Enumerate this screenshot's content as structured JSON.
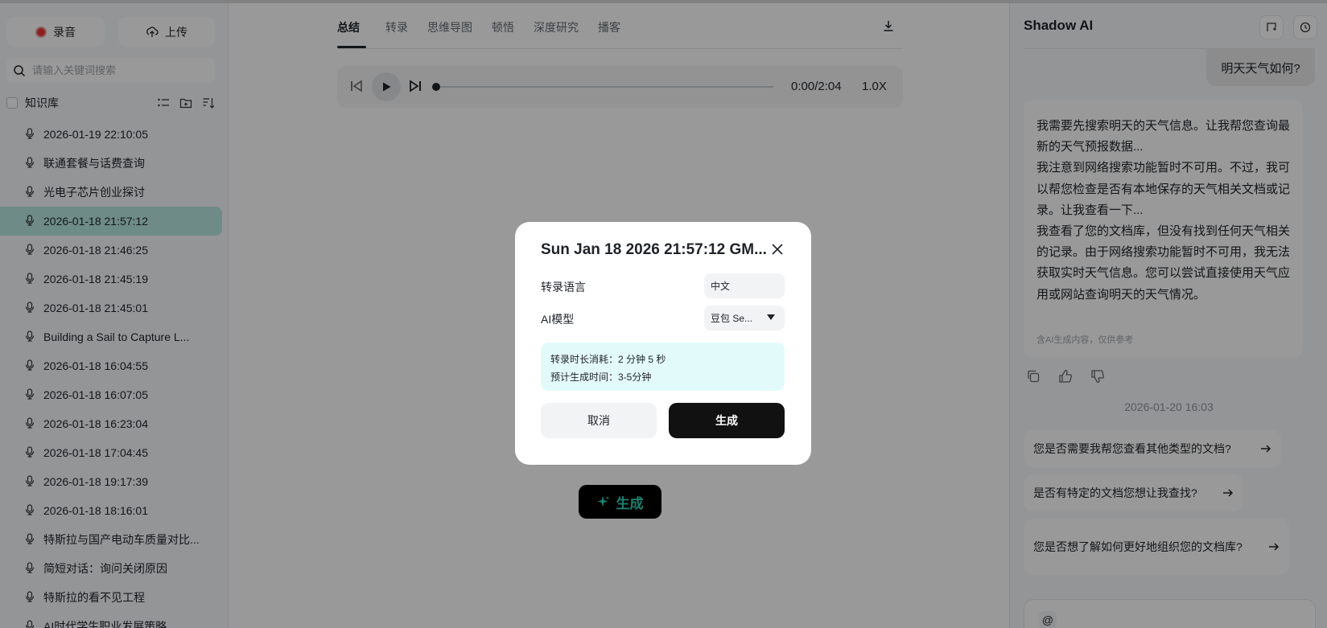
{
  "sidebar": {
    "record_label": "录音",
    "upload_label": "上传",
    "search_placeholder": "请输入关键词搜索",
    "kb_label": "知识库",
    "items": [
      "2026-01-19 22:10:05",
      "联通套餐与话费查询",
      "光电子芯片创业探讨",
      "2026-01-18 21:57:12",
      "2026-01-18 21:46:25",
      "2026-01-18 21:45:19",
      "2026-01-18 21:45:01",
      "Building a Sail to Capture L...",
      "2026-01-18 16:04:55",
      "2026-01-18 16:07:05",
      "2026-01-18 16:23:04",
      "2026-01-18 17:04:45",
      "2026-01-18 19:17:39",
      "2026-01-18 18:16:01",
      "特斯拉与国产电动车质量对比...",
      "简短对话：询问关闭原因",
      "特斯拉的看不见工程",
      "AI时代学生职业发展策略"
    ],
    "active_index": 3
  },
  "main": {
    "tabs": [
      "总结",
      "转录",
      "思维导图",
      "顿悟",
      "深度研究",
      "播客"
    ],
    "active_tab": 0,
    "player": {
      "time": "0:00/2:04",
      "speed": "1.0X"
    },
    "generate_label": "生成"
  },
  "assistant": {
    "title": "Shadow AI",
    "user_message": "明天天气如何?",
    "ai_lines": [
      "我需要先搜索明天的天气信息。让我帮您查询最新的天气预报数据...",
      "我注意到网络搜索功能暂时不可用。不过，我可以帮您检查是否有本地保存的天气相关文档或记录。让我查看一下...",
      "我查看了您的文档库，但没有找到任何天气相关的记录。由于网络搜索功能暂时不可用，我无法获取实时天气信息。您可以尝试直接使用天气应用或网站查询明天的天气情况。"
    ],
    "ai_note": "含AI生成内容，仅供参考",
    "timestamp": "2026-01-20 16:03",
    "suggestions": [
      "您是否需要我帮您查看其他类型的文档?",
      "是否有特定的文档您想让我查找?",
      "您是否想了解如何更好地组织您的文档库?"
    ],
    "input_at": "@"
  },
  "modal": {
    "title": "Sun Jan 18 2026 21:57:12 GM...",
    "lang_label": "转录语言",
    "lang_value": "中文",
    "model_label": "AI模型",
    "model_value": "豆包 Se...",
    "info_line1": "转录时长消耗：2 分钟 5 秒",
    "info_line2": "预计生成时间：3-5分钟",
    "cancel_label": "取消",
    "generate_label": "生成"
  },
  "colors": {
    "accent_teal": "#2fd3b8",
    "active_item_bg": "#b9e8e2",
    "record_red": "#e53935",
    "info_bg": "#e3fafa"
  }
}
